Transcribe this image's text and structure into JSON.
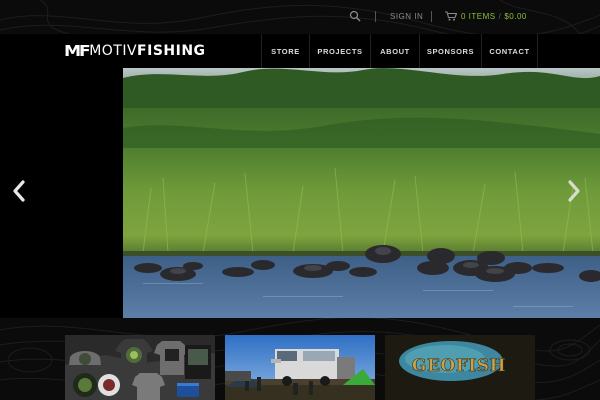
{
  "topbar": {
    "signin_label": "SIGN IN",
    "cart_count": "0 ITEMS",
    "cart_separator": "/",
    "cart_total": "$0.00"
  },
  "header": {
    "logo_mark": "MF",
    "logo_word_1": "MOTIV",
    "logo_word_2": "FISHING"
  },
  "nav": {
    "items": [
      "STORE",
      "PROJECTS",
      "ABOUT",
      "SPONSORS",
      "CONTACT"
    ]
  },
  "thumbnails": {
    "geofish_text": "GEOFISH"
  },
  "colors": {
    "accent_green": "#8fbe3e",
    "header_bg": "#000000",
    "page_bg": "#0b0b0b"
  },
  "icons": [
    "search-icon",
    "cart-icon",
    "chevron-left-icon",
    "chevron-right-icon"
  ]
}
